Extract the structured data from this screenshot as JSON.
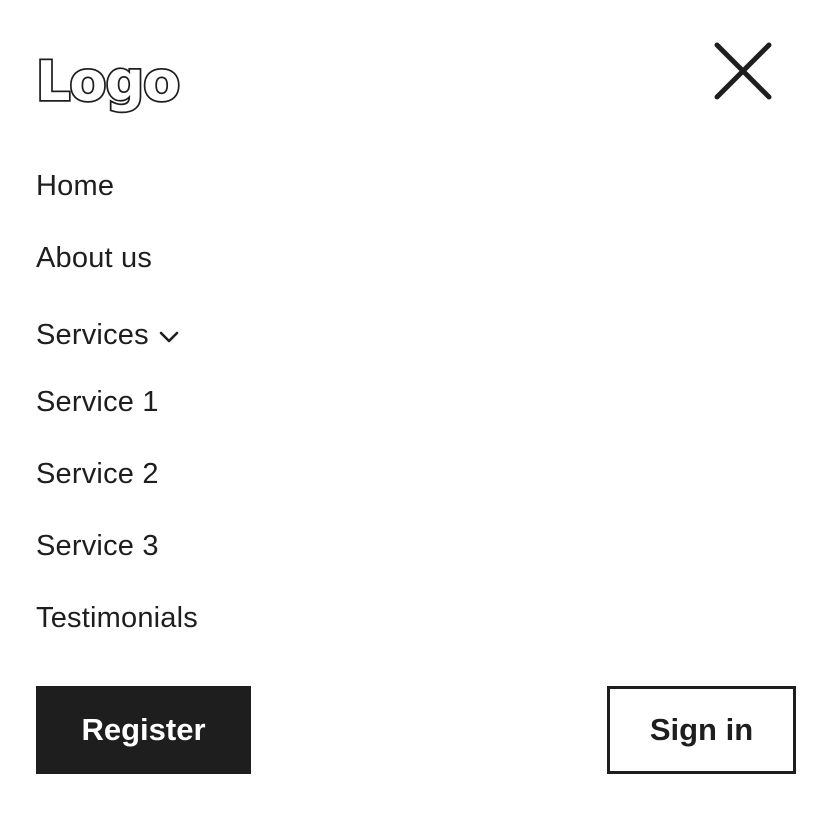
{
  "header": {
    "logo_text": "Logo",
    "close_icon": "close-icon"
  },
  "nav": {
    "items": [
      {
        "label": "Home"
      },
      {
        "label": "About us"
      },
      {
        "label": "Services",
        "icon": "chevron-down-icon",
        "expanded": true
      },
      {
        "label": "Service 1"
      },
      {
        "label": "Service 2"
      },
      {
        "label": "Service 3"
      },
      {
        "label": "Testimonials"
      }
    ]
  },
  "actions": {
    "register_label": "Register",
    "signin_label": "Sign in"
  },
  "colors": {
    "text": "#1e1e1e",
    "primary_button_bg": "#1e1e1e",
    "primary_button_text": "#ffffff",
    "background": "#ffffff"
  }
}
